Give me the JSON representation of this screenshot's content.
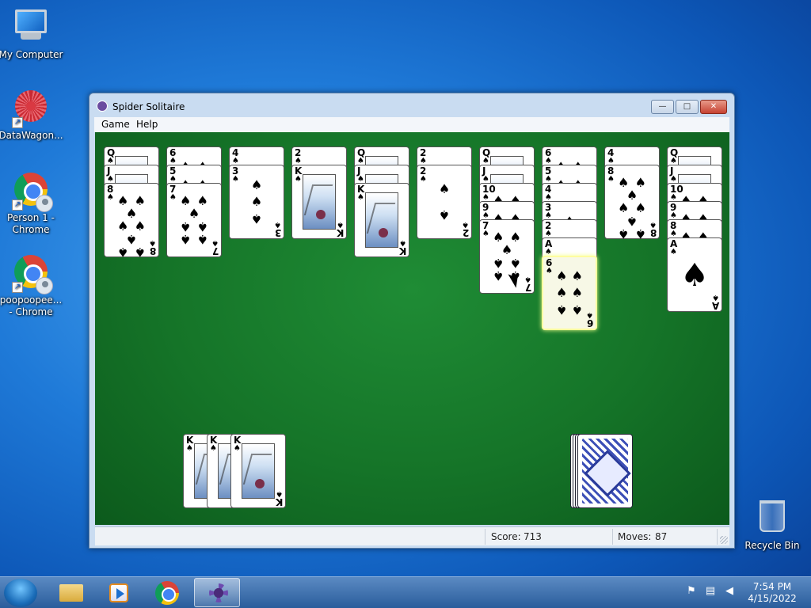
{
  "desktop": {
    "icons": [
      {
        "label": "My Computer"
      },
      {
        "label": "DataWagon..."
      },
      {
        "label": "Person 1 - Chrome"
      },
      {
        "label": "poopoopee... - Chrome"
      }
    ],
    "recycle_bin": "Recycle Bin"
  },
  "window": {
    "title": "Spider Solitaire",
    "menu": [
      "Game",
      "Help"
    ],
    "buttons": {
      "minimize": "—",
      "maximize": "□",
      "close": "✕"
    }
  },
  "game": {
    "tableau": [
      {
        "face_up": [
          "Q",
          "J",
          "8"
        ]
      },
      {
        "face_up": [
          "6",
          "5",
          "7"
        ]
      },
      {
        "face_up": [
          "4",
          "3"
        ]
      },
      {
        "face_up": [
          "2",
          "K"
        ]
      },
      {
        "face_up": [
          "Q",
          "J",
          "K"
        ]
      },
      {
        "face_up": [
          "2",
          "2"
        ]
      },
      {
        "face_up": [
          "Q",
          "J",
          "10",
          "9",
          "7"
        ]
      },
      {
        "face_up": [
          "6",
          "5",
          "4",
          "3",
          "2",
          "A",
          "6"
        ]
      },
      {
        "face_up": [
          "4",
          "8"
        ]
      },
      {
        "face_up": [
          "Q",
          "J",
          "10",
          "9",
          "8",
          "A"
        ]
      }
    ],
    "completed_kings": [
      "K",
      "K",
      "K"
    ],
    "suit_symbol": "♠",
    "stock_remaining_piles": 4
  },
  "status": {
    "score_label": "Score:",
    "score_value": "713",
    "moves_label": "Moves:",
    "moves_value": "87"
  },
  "taskbar": {
    "pinned": [
      "start-button",
      "explorer",
      "media-player",
      "chrome",
      "spider-solitaire"
    ],
    "active": "spider-solitaire",
    "tray_icons": [
      "action-center-icon",
      "network-icon",
      "volume-icon"
    ],
    "time": "7:54 PM",
    "date": "4/15/2022"
  }
}
